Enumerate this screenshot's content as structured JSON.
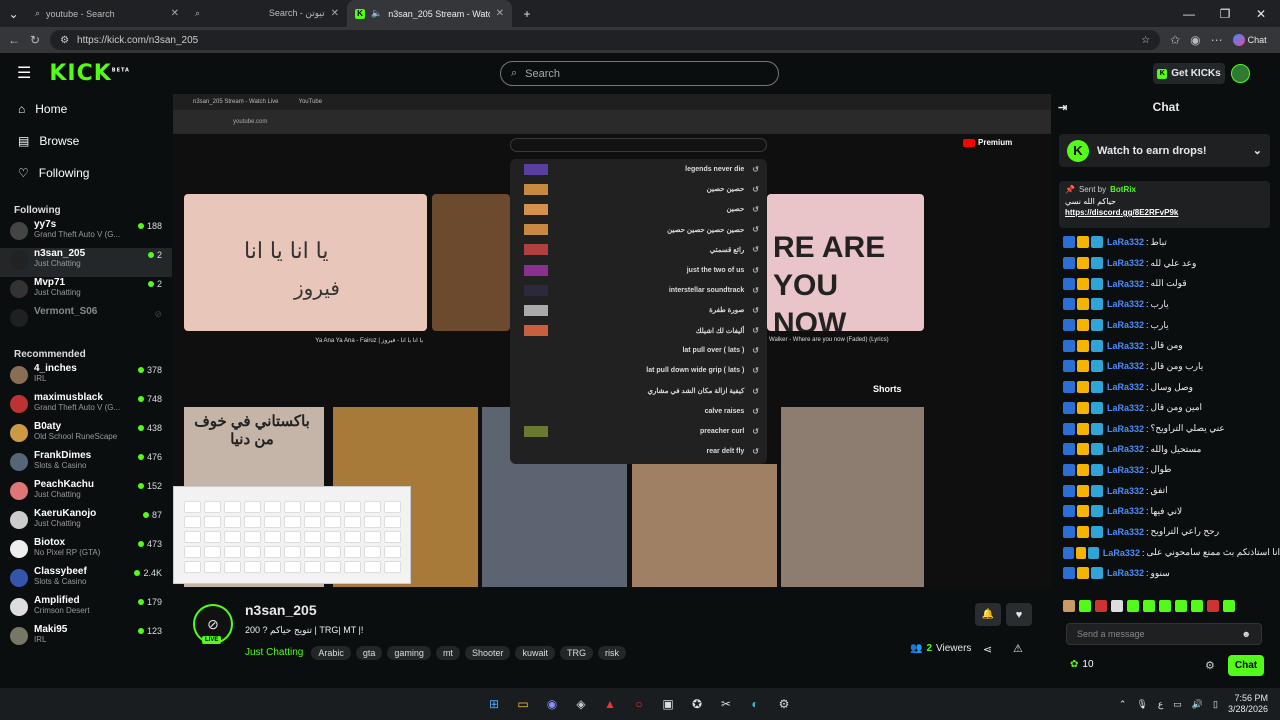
{
  "browser": {
    "tabs": [
      {
        "label": "youtube - Search"
      },
      {
        "label": "Search - تيوتن"
      },
      {
        "label": "n3san_205 Stream - Watch Live"
      }
    ],
    "url": "https://kick.com/n3san_205",
    "chat_label": "Chat"
  },
  "header": {
    "logo": "KICK",
    "logo_sup": "BETA",
    "search_placeholder": "Search",
    "get_kicks": "Get KICKs"
  },
  "sidebar": {
    "nav": [
      {
        "label": "Home",
        "icon": "home-icon"
      },
      {
        "label": "Browse",
        "icon": "browse-icon"
      },
      {
        "label": "Following",
        "icon": "heart-icon"
      }
    ],
    "following_title": "Following",
    "following": [
      {
        "name": "yy7s",
        "category": "Grand Theft Auto V (G...",
        "viewers": "188",
        "color": "#444"
      },
      {
        "name": "n3san_205",
        "category": "Just Chatting",
        "viewers": "2",
        "color": "#222"
      },
      {
        "name": "Mvp71",
        "category": "Just Chatting",
        "viewers": "2",
        "color": "#333"
      },
      {
        "name": "Vermont_S06",
        "category": "",
        "viewers": "",
        "color": "#333"
      }
    ],
    "recommended_title": "Recommended",
    "recommended": [
      {
        "name": "4_inches",
        "category": "IRL",
        "viewers": "378",
        "color": "#8a6d55"
      },
      {
        "name": "maximusblack",
        "category": "Grand Theft Auto V (G...",
        "viewers": "748",
        "color": "#b33"
      },
      {
        "name": "B0aty",
        "category": "Old School RuneScape",
        "viewers": "438",
        "color": "#c94"
      },
      {
        "name": "FrankDimes",
        "category": "Slots & Casino",
        "viewers": "476",
        "color": "#567"
      },
      {
        "name": "PeachKachu",
        "category": "Just Chatting",
        "viewers": "152",
        "color": "#d77"
      },
      {
        "name": "KaeruKanojo",
        "category": "Just Chatting",
        "viewers": "87",
        "color": "#ccc"
      },
      {
        "name": "Biotox",
        "category": "No Pixel RP (GTA)",
        "viewers": "473",
        "color": "#eee"
      },
      {
        "name": "Classybeef",
        "category": "Slots & Casino",
        "viewers": "2.4K",
        "color": "#35a"
      },
      {
        "name": "Amplified",
        "category": "Crimson Desert",
        "viewers": "179",
        "color": "#ddd"
      },
      {
        "name": "Maki95",
        "category": "IRL",
        "viewers": "123",
        "color": "#776"
      }
    ]
  },
  "video": {
    "yt_tab": "YouTube",
    "yt_stream_tab": "n3san_205 Stream - Watch Live",
    "yt_url": "youtube.com",
    "yt_premium": "Premium",
    "suggestions": [
      "legends never die",
      "حصين حصين",
      "حصين",
      "حصين حصين حصين حصين",
      "رائع قسمتي",
      "just the two of us",
      "interstellar soundtrack",
      "صورة طفرة",
      "أليفات لك اشيلك",
      "lat pull over ( lats )",
      "lat pull down wide grip ( lats )",
      "كيفية ازالة مكان الشد في مشاري",
      "calve raises",
      "preacher curl",
      "rear delt fly"
    ],
    "video1_title": "Ya Ana Ya Ana - Fairuz | يا انا يا انا - فيروز",
    "video1_text": "يا انا يا انا",
    "video1_sig": "فيروز",
    "video3_title": "Walker - Where are you now (Faded) (Lyrics)",
    "video3_text": "RE ARE YOU NOW",
    "shorts_label": "Shorts",
    "short1_text": "باكستاني في خوف من دنيا"
  },
  "stream": {
    "channel": "n3san_205",
    "live_label": "LIVE",
    "title": "تتويج حياكم ? 200 | TRG| MT |!",
    "category": "Just Chatting",
    "tags": [
      "Arabic",
      "gta",
      "gaming",
      "mt",
      "Shooter",
      "kuwait",
      "TRG",
      "risk"
    ],
    "viewers": "2",
    "viewers_label": "Viewers"
  },
  "chat": {
    "title": "Chat",
    "earn_drops": "Watch to earn drops!",
    "pinned_by": "Sent by",
    "pinned_author": "BotRix",
    "pinned_text": "حياكم الله نسي",
    "pinned_link": "https://discord.gg/8E2RFvP9k",
    "messages": [
      {
        "user": "LaRa332",
        "text": "تباط"
      },
      {
        "user": "LaRa332",
        "text": "وعد علي لله"
      },
      {
        "user": "LaRa332",
        "text": "قولت الله"
      },
      {
        "user": "LaRa332",
        "text": "يارب"
      },
      {
        "user": "LaRa332",
        "text": "يارب"
      },
      {
        "user": "LaRa332",
        "text": "ومن قال"
      },
      {
        "user": "LaRa332",
        "text": "يارب ومن قال"
      },
      {
        "user": "LaRa332",
        "text": "وصل وسال"
      },
      {
        "user": "LaRa332",
        "text": "امين ومن قال"
      },
      {
        "user": "LaRa332",
        "text": "عني يصلي التراويح؟"
      },
      {
        "user": "LaRa332",
        "text": "مستحيل والله"
      },
      {
        "user": "LaRa332",
        "text": "طوال"
      },
      {
        "user": "LaRa332",
        "text": "اتفق"
      },
      {
        "user": "LaRa332",
        "text": "لاني فيها"
      },
      {
        "user": "LaRa332",
        "text": "رحح راعي التراويح"
      },
      {
        "user": "LaRa332",
        "text": "انا استاذنكم بث ممنع سامحوني على"
      },
      {
        "user": "LaRa332",
        "text": "سنوو"
      }
    ],
    "message_placeholder": "Send a message",
    "kicks_count": "10",
    "chat_button": "Chat"
  },
  "taskbar": {
    "time": "7:56 PM",
    "date": "3/28/2026",
    "lang": "ع"
  }
}
